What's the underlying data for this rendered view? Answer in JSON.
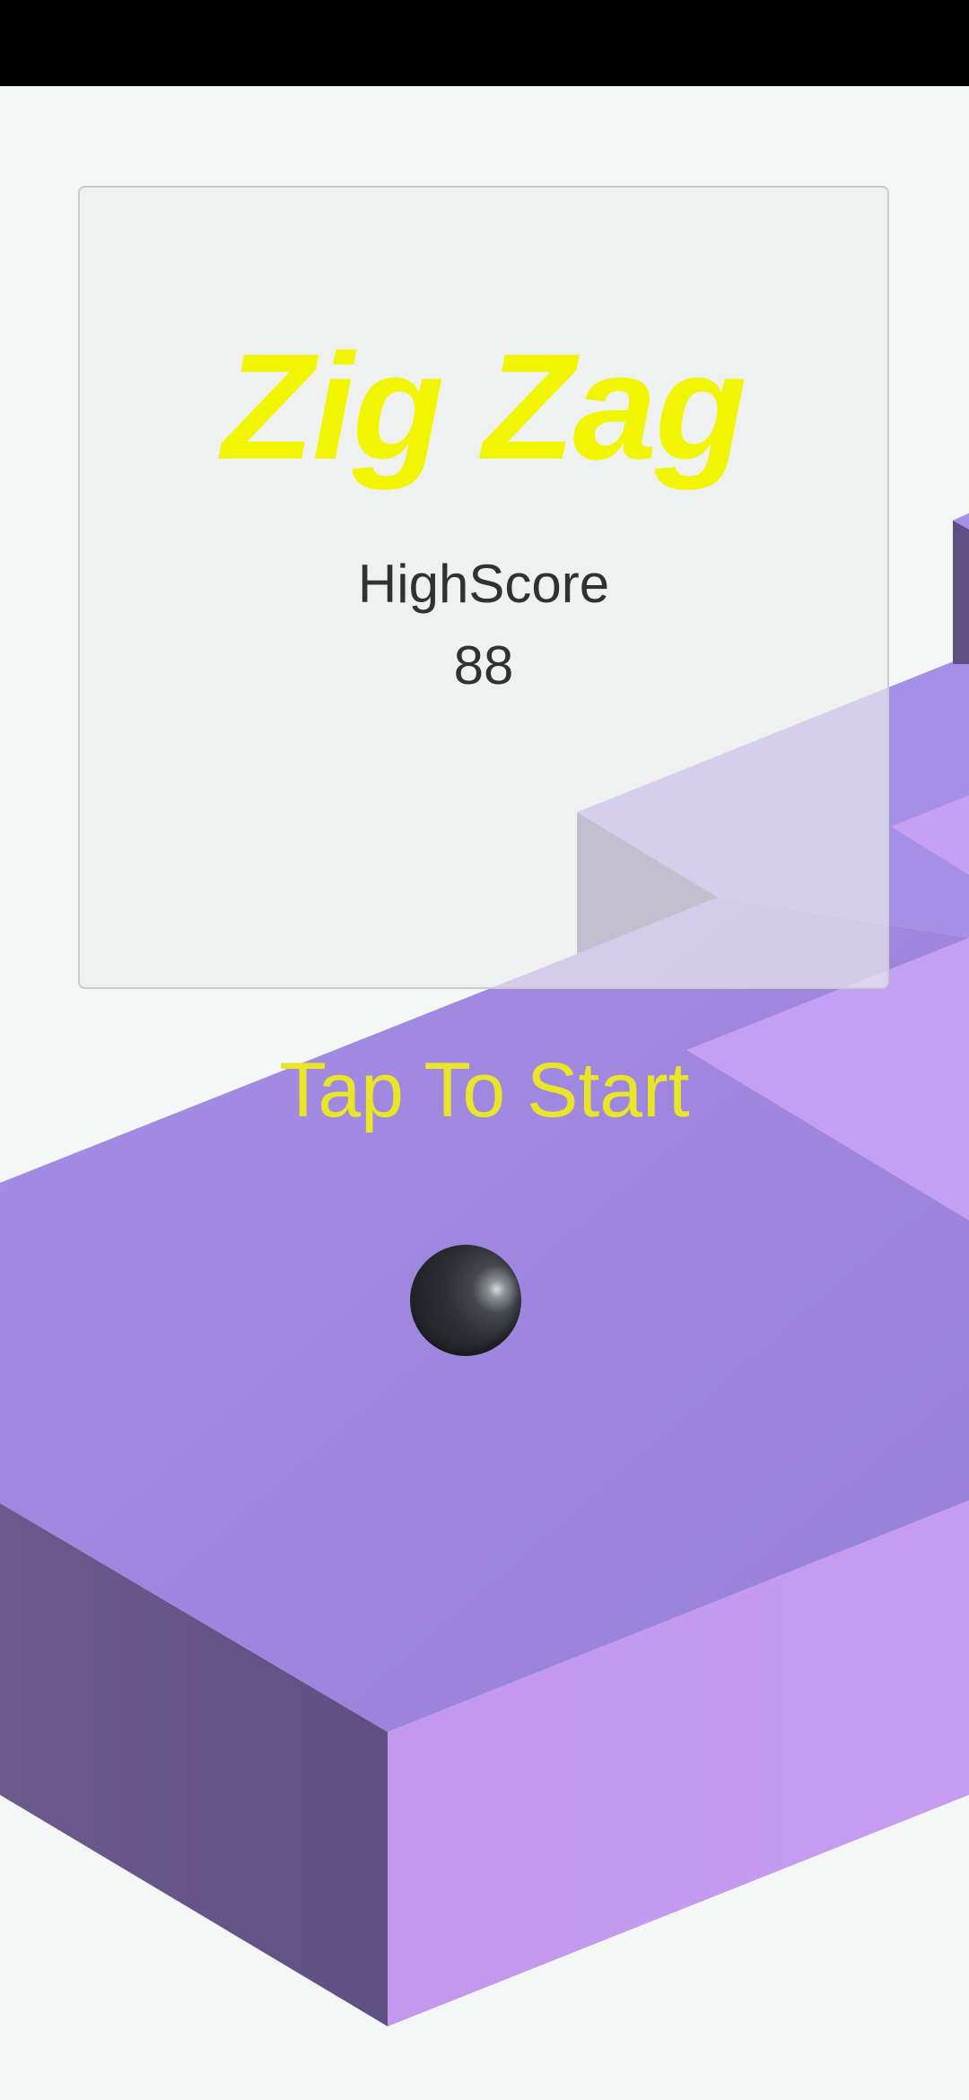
{
  "game": {
    "title": "Zig Zag",
    "highscore_label": "HighScore",
    "highscore_value": "88",
    "start_prompt": "Tap To Start"
  },
  "colors": {
    "title": "#f2f500",
    "start_prompt": "#e8e626",
    "highscore_text": "#2f3233",
    "path_top": "#9c86de",
    "path_side_light": "#c49bee",
    "path_side_dark": "#665486",
    "background": "#f5f7f7",
    "ball": "#2b2e33"
  },
  "icons": {
    "ball": "player-ball-icon"
  }
}
